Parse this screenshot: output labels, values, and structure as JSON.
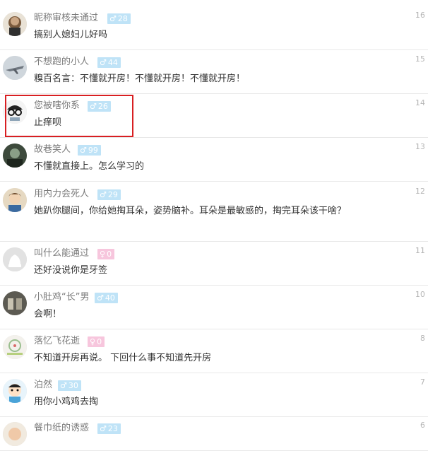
{
  "colors": {
    "name_text": "#7a7a7a",
    "comment_text": "#333333",
    "male_badge": "#bfe3f7",
    "female_badge": "#f7c6dd",
    "highlight_border": "#d81f22",
    "divider": "#e8e8e8"
  },
  "comments": [
    {
      "floor": "16",
      "username": "昵称审核未通过",
      "gender": "male",
      "gender_symbol": "♂",
      "level": "28",
      "text": "搞别人媳妇儿好吗",
      "avatar": "portrait-man-avatar"
    },
    {
      "floor": "15",
      "username": "不想跑的小人",
      "gender": "male",
      "gender_symbol": "♂",
      "level": "44",
      "text": "糗百名言：不懂就开房！不懂就开房！不懂就开房！",
      "avatar": "airplane-avatar"
    },
    {
      "floor": "14",
      "username": "您被嗐你系",
      "gender": "male",
      "gender_symbol": "♂",
      "level": "26",
      "text": "止痒呗",
      "avatar": "cartoon-glasses-avatar"
    },
    {
      "floor": "13",
      "username": "故巷笑人",
      "gender": "male",
      "gender_symbol": "♂",
      "level": "99",
      "text": "不懂就直接上。怎么学习的",
      "avatar": "dark-photo-avatar"
    },
    {
      "floor": "12",
      "username": "用内力会死人",
      "gender": "male",
      "gender_symbol": "♂",
      "level": "29",
      "text": "她趴你腿间，你给她掏耳朵，姿势脑补。耳朵是最敏感的，掏完耳朵该干啥？",
      "avatar": "anime-avatar"
    },
    {
      "floor": "11",
      "username": "叫什么能通过",
      "gender": "female",
      "gender_symbol": "♀",
      "level": "0",
      "text": "还好没说你是牙签",
      "avatar": "default-avatar"
    },
    {
      "floor": "10",
      "username": "小肚鸡“长”男",
      "gender": "male",
      "gender_symbol": "♂",
      "level": "40",
      "text": "会啊！",
      "avatar": "cups-photo-avatar"
    },
    {
      "floor": "8",
      "username": "落忆飞花逝",
      "gender": "female",
      "gender_symbol": "♀",
      "level": "0",
      "text": "不知道开房再说。 下回什么事不知道先开房",
      "avatar": "pattern-avatar"
    },
    {
      "floor": "7",
      "username": "泊然",
      "gender": "male",
      "gender_symbol": "♂",
      "level": "30",
      "text": "用你小鸡鸡去掏",
      "avatar": "cartoon-boy-avatar"
    },
    {
      "floor": "6",
      "username": "餐巾纸的诱惑",
      "gender": "male",
      "gender_symbol": "♂",
      "level": "23",
      "text": "",
      "avatar": "cartoon-avatar"
    }
  ]
}
